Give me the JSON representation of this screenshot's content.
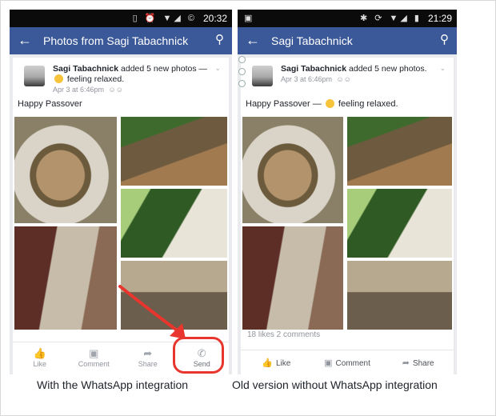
{
  "left_phone": {
    "status_time": "20:32",
    "status_icons": "▯ ⏰ ▼◢ ©",
    "title": "Photos from Sagi Tabachnick",
    "post": {
      "author": "Sagi Tabachnick",
      "action": "added 5 new photos — ",
      "feeling": "feeling relaxed.",
      "date": "Apr 3 at 6:46pm",
      "caption": "Happy Passover"
    },
    "actions": [
      "Like",
      "Comment",
      "Share",
      "Send"
    ]
  },
  "right_phone": {
    "status_time": "21:29",
    "status_icons": "✱ ⟳ ▼◢ ▮",
    "title": "Sagi Tabachnick",
    "post": {
      "author": "Sagi Tabachnick",
      "action": "added 5 new photos.",
      "caption": "Happy Passover — ",
      "feeling": "feeling relaxed.",
      "date": "Apr 3 at 6:46pm"
    },
    "stats": "18 likes  2 comments",
    "actions": [
      "Like",
      "Comment",
      "Share"
    ]
  },
  "labels": {
    "left": "With the WhatsApp integration",
    "right": "Old version without WhatsApp integration"
  },
  "colors": {
    "facebook_blue": "#3b5998",
    "highlight_red": "#e8362f"
  },
  "icons": {
    "back": "back-arrow-icon",
    "search": "search-icon",
    "like": "thumbs-up-icon",
    "comment": "comment-icon",
    "share": "share-arrow-icon",
    "send": "whatsapp-icon"
  }
}
